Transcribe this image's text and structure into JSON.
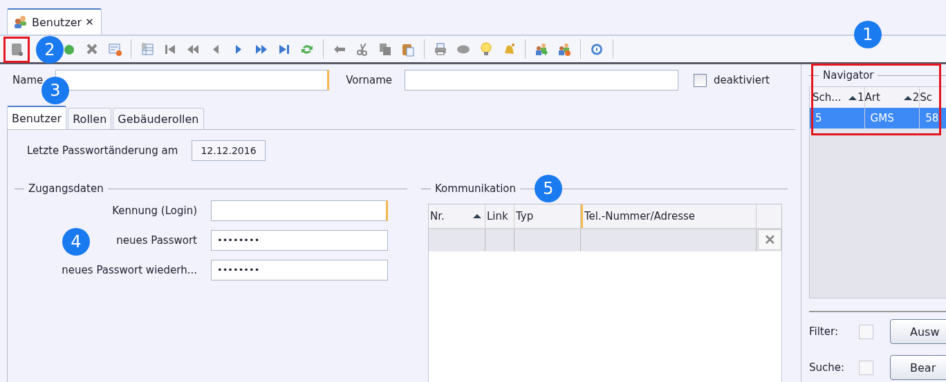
{
  "document_tab": {
    "title": "Benutzer",
    "close": "✕"
  },
  "form": {
    "name_label": "Name",
    "firstname_label": "Vorname",
    "deactivated": {
      "label": "deaktiviert",
      "checked": false
    }
  },
  "tabs": [
    {
      "label": "Benutzer",
      "selected": true
    },
    {
      "label": "Rollen",
      "selected": false
    },
    {
      "label": "Gebäuderollen",
      "selected": false
    }
  ],
  "password_change": {
    "label": "Letzte Passwortänderung am",
    "value": "12.12.2016"
  },
  "access": {
    "title": "Zugangsdaten",
    "fields": [
      {
        "label": "Kennung (Login)",
        "required": true
      },
      {
        "label": "neues Passwort",
        "value": "••••••••",
        "required": false
      },
      {
        "label": "neues Passwort wiederh...",
        "value": "••••••••",
        "required": false
      }
    ]
  },
  "communication": {
    "title": "Kommunikation",
    "columns": [
      "Nr.",
      "Link",
      "Typ",
      "Tel.-Nummer/Adresse"
    ],
    "remove": "✕"
  },
  "navigator": {
    "title": "Navigator",
    "columns": [
      {
        "label": "Sch...",
        "sort": "1"
      },
      {
        "label": "Art",
        "sort": "2"
      },
      {
        "label": "Sc"
      }
    ],
    "rows": [
      {
        "cells": [
          "5",
          "GMS",
          "58"
        ],
        "selected": true
      }
    ]
  },
  "filters": [
    {
      "label": "Filter:",
      "checked": false,
      "button": "Ausw"
    },
    {
      "label": "Suche:",
      "checked": false,
      "button": "Bear"
    }
  ],
  "callouts": [
    "1",
    "2",
    "3",
    "4",
    "5"
  ]
}
